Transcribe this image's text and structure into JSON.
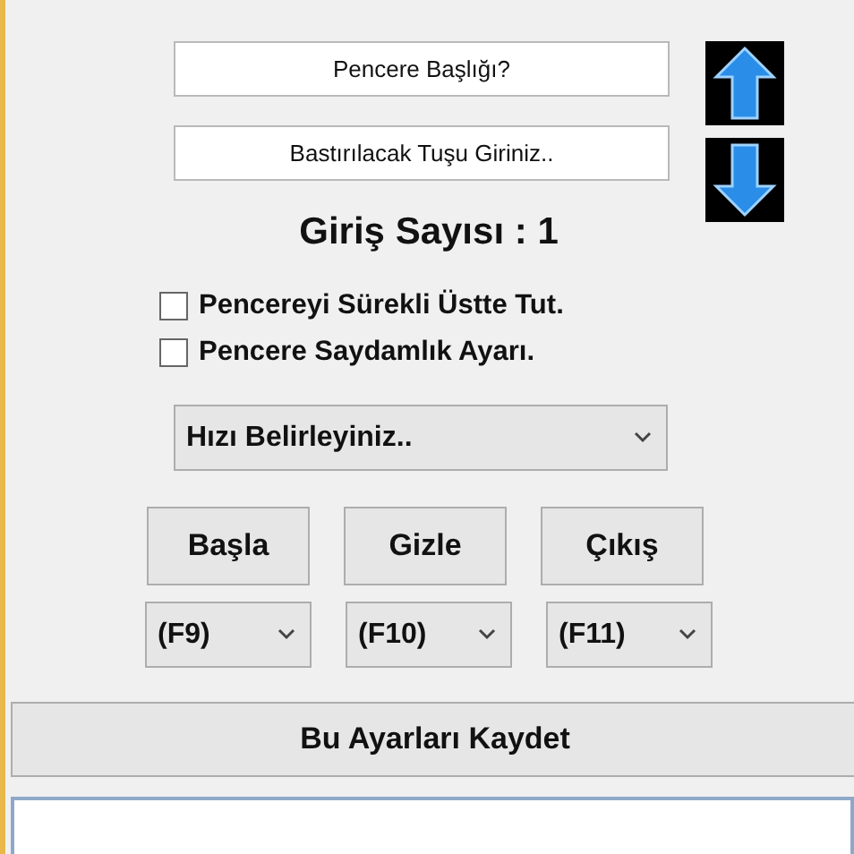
{
  "fields": [
    {
      "value": "Pencere Başlığı?"
    },
    {
      "value": "Bastırılacak Tuşu Giriniz.."
    }
  ],
  "counter": "Giriş Sayısı : 1",
  "checkboxes": [
    {
      "label": "Pencereyi Sürekli Üstte Tut.",
      "checked": false
    },
    {
      "label": "Pencere Saydamlık Ayarı.",
      "checked": false
    }
  ],
  "speed_select": {
    "value": "Hızı Belirleyiniz.."
  },
  "actions": [
    {
      "label": "Başla",
      "hotkey": "(F9)"
    },
    {
      "label": "Gizle",
      "hotkey": "(F10)"
    },
    {
      "label": "Çıkış",
      "hotkey": "(F11)"
    }
  ],
  "save_button": "Bu Ayarları Kaydet"
}
